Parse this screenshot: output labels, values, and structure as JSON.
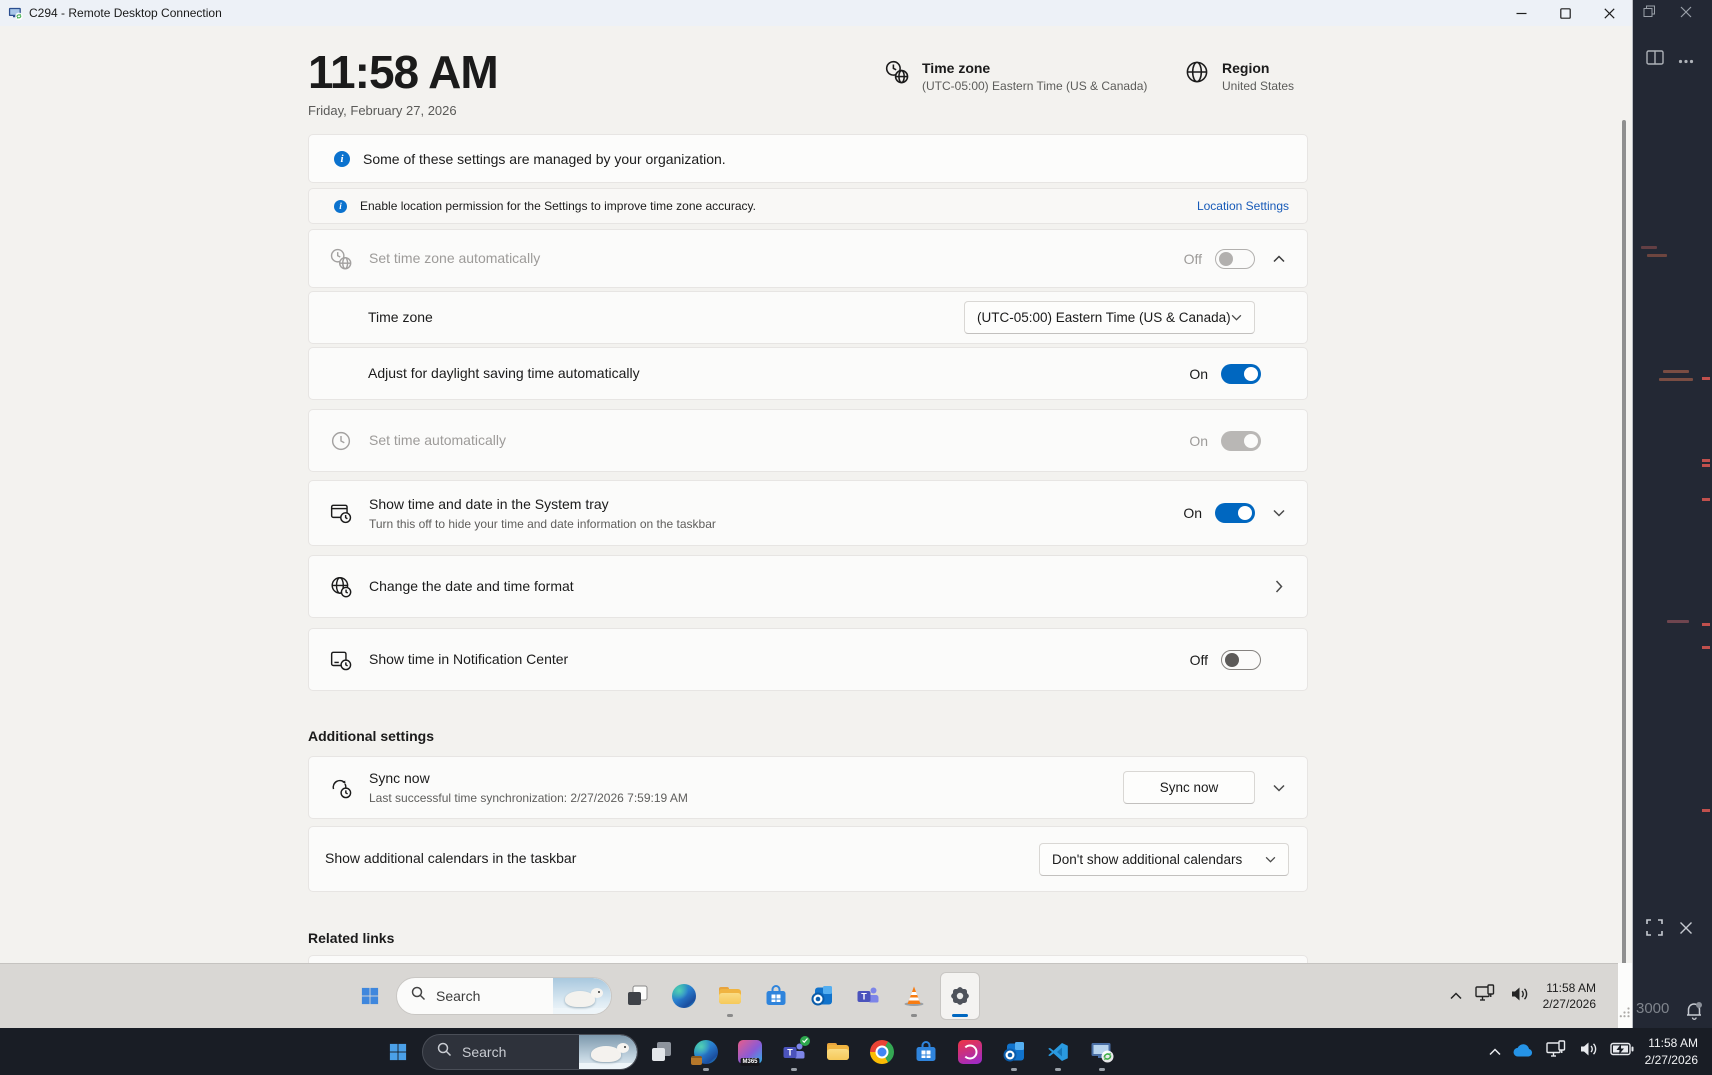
{
  "window": {
    "title": "C294 - Remote Desktop Connection"
  },
  "page": {
    "clock": "11:58 AM",
    "date": "Friday, February 27, 2026",
    "timezone_header": {
      "title": "Time zone",
      "subtitle": "(UTC-05:00) Eastern Time (US & Canada)"
    },
    "region_header": {
      "title": "Region",
      "subtitle": "United States"
    },
    "banners": [
      {
        "text": "Some of these settings are managed by your organization."
      },
      {
        "text": "Enable location permission for the Settings to improve time zone accuracy.",
        "link": "Location Settings"
      }
    ],
    "rows": {
      "set_tz_auto": {
        "label": "Set time zone automatically",
        "state": "Off"
      },
      "time_zone": {
        "label": "Time zone",
        "value": "(UTC-05:00) Eastern Time (US & Canada)"
      },
      "dst": {
        "label": "Adjust for daylight saving time automatically",
        "state": "On"
      },
      "set_time_auto": {
        "label": "Set time automatically",
        "state": "On"
      },
      "system_tray": {
        "label": "Show time and date in the System tray",
        "sub": "Turn this off to hide your time and date information on the taskbar",
        "state": "On"
      },
      "change_format": {
        "label": "Change the date and time format"
      },
      "notification_center": {
        "label": "Show time in Notification Center",
        "state": "Off"
      },
      "sync": {
        "label": "Sync now",
        "sub": "Last successful time synchronization: 2/27/2026 7:59:19 AM",
        "button": "Sync now"
      },
      "calendars": {
        "label": "Show additional calendars in the taskbar",
        "value": "Don't show additional calendars"
      }
    },
    "sections": {
      "additional": "Additional settings",
      "related": "Related links"
    }
  },
  "remote_taskbar": {
    "search": "Search",
    "time": "11:58 AM",
    "date": "2/27/2026"
  },
  "host_taskbar": {
    "search": "Search",
    "time": "11:58 AM",
    "date": "2/27/2026",
    "m365": "M365"
  },
  "side_panel": {
    "port": "3000"
  },
  "icons": {
    "info-icon": "i in blue circle",
    "timezone-icon": "clock with globe",
    "region-icon": "globe",
    "clock-icon": "clock outline",
    "systray-clock-icon": "panel with clock",
    "format-globe-clock-icon": "globe with clock",
    "notification-clock-icon": "panel with clock",
    "sync-icon": "circular arrows with clock",
    "settings-gear-icon": "gear"
  },
  "colors": {
    "accent": "#0067C0",
    "link": "#175ab8",
    "info": "#0b72ce",
    "card_bg": "#fbfbfa",
    "page_bg": "#f3f2ef",
    "host_taskbar_bg": "#191d25",
    "remote_taskbar_bg": "#d9d7d4",
    "ruler_mark": "#c0504d"
  }
}
